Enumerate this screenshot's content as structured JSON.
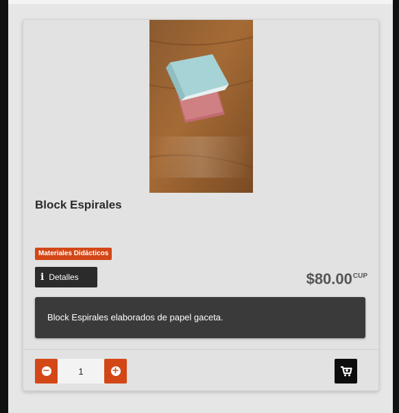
{
  "product": {
    "title": "Block Espirales",
    "category": "Materiales Didácticos",
    "details_label": "Detalles",
    "price": "$80.00",
    "currency": "CUP",
    "description": "Block Espirales elaborados de papel gaceta.",
    "quantity": "1"
  },
  "colors": {
    "accent": "#d34717",
    "dark": "#2b2b2b",
    "card_bg": "#e2e2e2"
  },
  "icons": {
    "details": "info-icon",
    "decrease": "minus-circle-icon",
    "increase": "plus-circle-icon",
    "cart": "shopping-cart-icon"
  }
}
